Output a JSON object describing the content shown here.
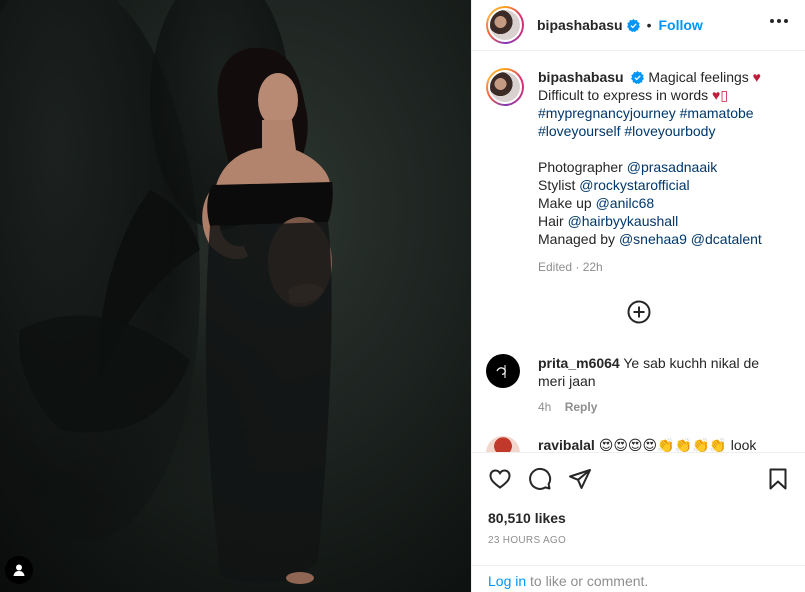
{
  "post": {
    "image_alt": "Woman in sheer black outfit against dark backdrop",
    "header": {
      "username": "bipashabasu",
      "separator": "•",
      "follow_label": "Follow"
    },
    "caption": {
      "username": "bipashabasu",
      "line1": "Magical feelings",
      "line1_emoji": "♥",
      "line2": "Difficult to express in words",
      "line2_emoji": "♥▯",
      "hashtags_line1": [
        "#mypregnancyjourney",
        "#mamatobe"
      ],
      "hashtags_line2": [
        "#loveyourself",
        "#loveyourbody"
      ],
      "credits": [
        {
          "role": "Photographer",
          "handle": "@prasadnaaik"
        },
        {
          "role": "Stylist",
          "handle": "@rockystarofficial"
        },
        {
          "role": "Make up",
          "handle": "@anilc68"
        },
        {
          "role": "Hair",
          "handle": "@hairbyykaushall"
        }
      ],
      "managed_by_label": "Managed by",
      "managed_by_handles": [
        "@snehaa9",
        "@dcatalent"
      ],
      "edited_meta": "Edited · 22h"
    },
    "comments": [
      {
        "username": "prita_m6064",
        "text": "Ye sab kuchh nikal de meri jaan",
        "age": "4h",
        "reply_label": "Reply"
      },
      {
        "username": "ravibalal",
        "text": "😍😍😍😍👏👏👏👏 look so"
      }
    ],
    "likes": "80,510 likes",
    "time_ago": "23 HOURS AGO",
    "login_link": "Log in",
    "login_suffix": " to like or comment."
  },
  "colors": {
    "accent": "#0095f6",
    "hashtag": "#00376b",
    "heart": "#c01d3a",
    "muted": "#8e8e8e"
  },
  "icons": [
    "verified-icon",
    "more-options-icon",
    "load-more-comments-icon",
    "like-icon",
    "comment-icon",
    "share-icon",
    "save-icon",
    "user-tag-icon"
  ]
}
